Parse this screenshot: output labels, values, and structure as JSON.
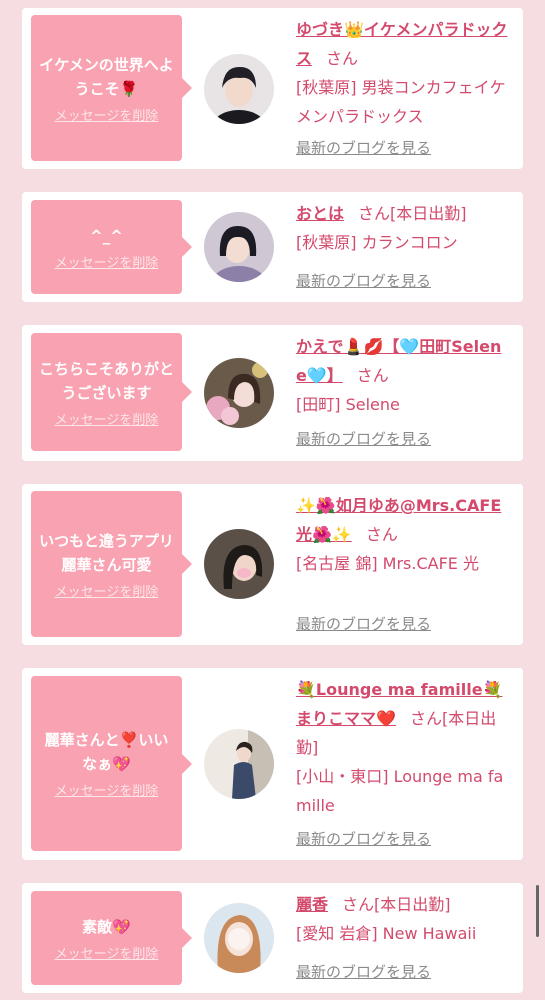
{
  "delete_label": "メッセージを削除",
  "blog_label": "最新のブログを見る",
  "san": "さん",
  "cards": [
    {
      "message": "イケメンの世界へようこそ🌹",
      "name": "ゆづき👑イケメンパラドックス",
      "status": "",
      "shop": "[秋葉原] 男装コンカフェイケメンパラドックス",
      "avatar": "dark-hair-person"
    },
    {
      "message": "^_^",
      "name": "おとは",
      "status": "[本日出勤]",
      "shop": "[秋葉原] カランコロン",
      "avatar": "bob-hair-girl"
    },
    {
      "message": "こちらこそありがとうございます",
      "name": "かえで💄💋【🩵田町Selene🩵】",
      "status": "",
      "shop": "[田町] Selene",
      "avatar": "girl-with-flowers"
    },
    {
      "message": "いつもと違うアプリ麗華さん可愛",
      "name": "✨🌺如月ゆあ@Mrs.CAFE光🌺✨",
      "status": "",
      "shop": "[名古屋 錦] Mrs.CAFE 光",
      "avatar": "dark-hair-woman"
    },
    {
      "message": "麗華さんと❣️いいなぁ💖",
      "name": "💐Lounge ma famille💐まりこママ❤️",
      "status": "[本日出勤]",
      "shop": "[小山・東口] Lounge ma famille",
      "avatar": "kimono-woman"
    },
    {
      "message": "素敵💖",
      "name": "麗香",
      "status": "[本日出勤]",
      "shop": "[愛知 岩倉] New Hawaii",
      "avatar": "light-hair-woman"
    }
  ],
  "colors": {
    "background": "#f6dde2",
    "message_box": "#f9a2b1",
    "name_text": "#d34a6c",
    "link_gray": "#8a8a8a"
  }
}
